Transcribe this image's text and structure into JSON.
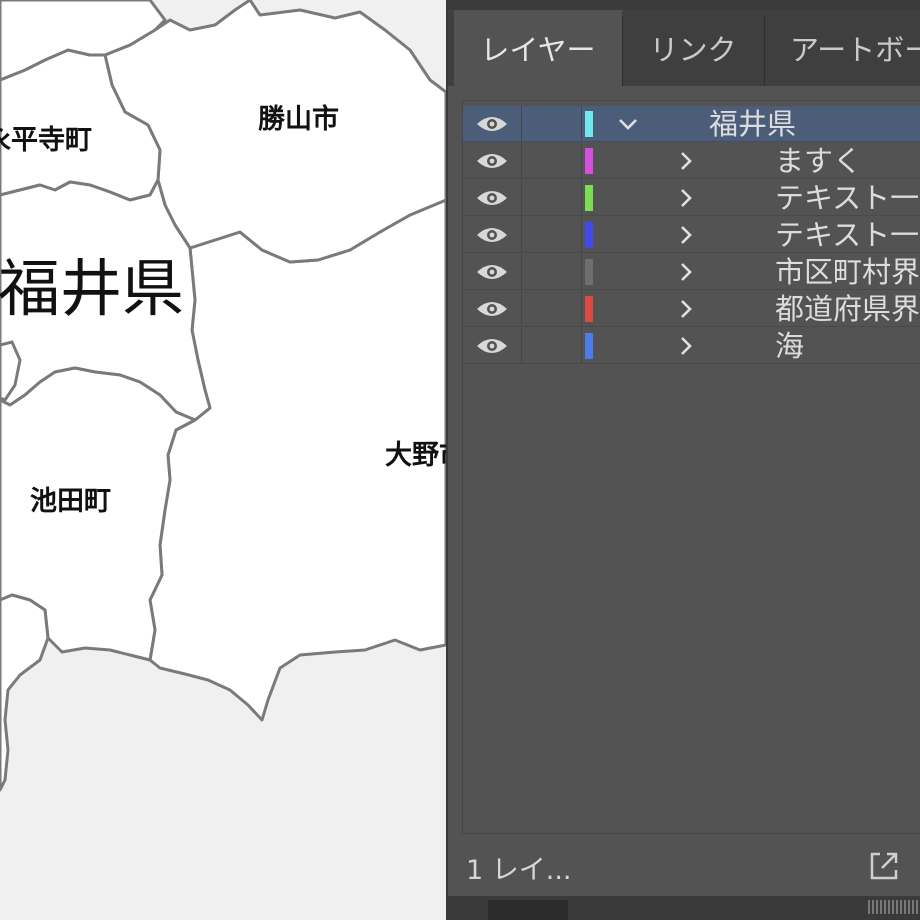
{
  "map": {
    "prefecture_label": "福井県",
    "labels": {
      "eiheiji": "永平寺町",
      "katsuyama": "勝山市",
      "ikeda": "池田町",
      "ono": "大野市"
    },
    "colors": {
      "background": "#f0f0f0",
      "land": "#ffffff",
      "border": "#7a7a7a"
    }
  },
  "panel": {
    "tabs": [
      {
        "label": "レイヤー",
        "active": true
      },
      {
        "label": "リンク",
        "active": false
      },
      {
        "label": "アートボード",
        "active": false
      }
    ],
    "layers": [
      {
        "name": "福井県",
        "color": "#6fe8f0",
        "expanded": true,
        "selected": true,
        "visible": true
      },
      {
        "name": "ますく",
        "color": "#d74fe0",
        "expanded": false,
        "selected": false,
        "visible": true
      },
      {
        "name": "テキスト一般",
        "color": "#78e050",
        "expanded": false,
        "selected": false,
        "visible": true
      },
      {
        "name": "テキスト一県",
        "color": "#4248f0",
        "expanded": false,
        "selected": false,
        "visible": true
      },
      {
        "name": "市区町村界",
        "color": "#6e6e6e",
        "expanded": false,
        "selected": false,
        "visible": true
      },
      {
        "name": "都道府県界",
        "color": "#e0493f",
        "expanded": false,
        "selected": false,
        "visible": true
      },
      {
        "name": "海",
        "color": "#4c7cf0",
        "expanded": false,
        "selected": false,
        "visible": true
      }
    ],
    "footer": {
      "count_label": "1 レイ..."
    },
    "icons": {
      "visibility": "eye-icon",
      "collapse": "chevron-down-icon",
      "expand": "chevron-right-icon",
      "export": "export-icon"
    },
    "colors": {
      "panel": "#535353",
      "tabbar": "#3f3f3f",
      "selected_row": "#4b5d78",
      "text": "#dcdcdc"
    }
  }
}
